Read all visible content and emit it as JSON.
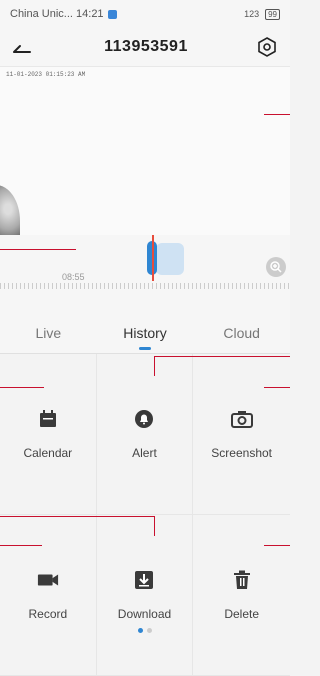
{
  "status": {
    "carrier_time": "China Unic... 14:21",
    "right_text": "123",
    "battery": "99"
  },
  "header": {
    "title": "113953591"
  },
  "video": {
    "timestamp": "11-01-2023 01:15:23 AM"
  },
  "timeline": {
    "time_label": "08:55"
  },
  "tabs": [
    {
      "label": "Live"
    },
    {
      "label": "History"
    },
    {
      "label": "Cloud"
    }
  ],
  "actions": [
    {
      "label": "Calendar",
      "icon": "calendar-icon"
    },
    {
      "label": "Alert",
      "icon": "bell-icon"
    },
    {
      "label": "Screenshot",
      "icon": "camera-icon"
    },
    {
      "label": "Record",
      "icon": "video-camera-icon"
    },
    {
      "label": "Download",
      "icon": "download-icon"
    },
    {
      "label": "Delete",
      "icon": "trash-icon"
    }
  ],
  "colors": {
    "accent": "#2f86d2",
    "annotation": "#c8102e"
  }
}
